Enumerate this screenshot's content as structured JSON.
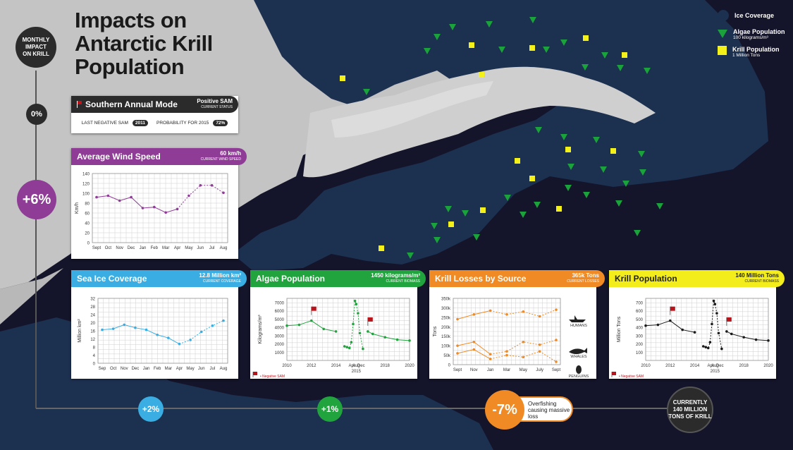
{
  "title": [
    "Impacts on",
    "Antarctic Krill",
    "Population"
  ],
  "timeline": {
    "header": [
      "MONTHLY",
      "IMPACT",
      "ON KRILL"
    ],
    "start": "0%",
    "wind_impact": "+6%",
    "ice_impact": "+2%",
    "algae_impact": "+1%",
    "losses_impact": "-7%",
    "losses_note": [
      "Overfishing",
      "causing massive",
      "loss"
    ],
    "final": [
      "CURRENTLY",
      "140 MILLION",
      "TONS OF KRILL"
    ]
  },
  "legend": {
    "ice": {
      "label": "Ice Coverage",
      "color": "#1b2f4f"
    },
    "algae": {
      "label": "Algae Population",
      "sub": "100 kilograms/m³",
      "color": "#1aa33a"
    },
    "krill": {
      "label": "Krill Population",
      "sub": "1 Million Tons",
      "color": "#f4f01a"
    }
  },
  "sam": {
    "title": "Southern Annual Mode",
    "status": "Positive SAM",
    "status_sub": "CURRENT STATUS",
    "last_label": "LAST NEGATIVE SAM",
    "last_value": "2011",
    "prob_label": "PROBABILITY FOR 2015",
    "prob_value": "72%"
  },
  "panels": {
    "wind": {
      "title": "Average Wind Speed",
      "value": "60 km/h",
      "sub": "CURRENT WIND SPEED",
      "color": "#8e3c95"
    },
    "ice": {
      "title": "Sea Ice Coverage",
      "value": "12.8 Million km²",
      "sub": "CURRENT COVERAGE",
      "color": "#3aaee2"
    },
    "algae": {
      "title": "Algae Population",
      "value": "1450 kilograms/m³",
      "sub": "CURRENT BIOMASS",
      "color": "#21a33e",
      "note": "Negative SAM"
    },
    "losses": {
      "title": "Krill Losses by Source",
      "value": "365k Tons",
      "sub": "CURRENT LOSSES",
      "color": "#f08a24"
    },
    "krill": {
      "title": "Krill Population",
      "value": "140 Million Tons",
      "sub": "CURRENT BIOMASS",
      "color": "#f3ee1b",
      "note": "Negative SAM"
    }
  },
  "chart_data": [
    {
      "type": "line",
      "title": "Average Wind Speed",
      "ylabel": "Km/h",
      "ylim": [
        0,
        140
      ],
      "yticks": [
        "0",
        "20",
        "40",
        "60",
        "80",
        "100",
        "120",
        "140"
      ],
      "categories": [
        "Sept",
        "Oct",
        "Nov",
        "Dec",
        "Jan",
        "Feb",
        "Mar",
        "Apr",
        "May",
        "Jun",
        "Jul",
        "Aug"
      ],
      "values": [
        92,
        95,
        85,
        92,
        70,
        72,
        61,
        68,
        95,
        116,
        116,
        101
      ]
    },
    {
      "type": "line",
      "title": "Sea Ice Coverage",
      "ylabel": "Million km²",
      "ylim": [
        0,
        32
      ],
      "yticks": [
        "0",
        "4",
        "8",
        "12",
        "16",
        "20",
        "24",
        "28",
        "32"
      ],
      "categories": [
        "Sep",
        "Oct",
        "Nov",
        "Dec",
        "Jan",
        "Feb",
        "Mar",
        "Apr",
        "May",
        "Jun",
        "Jul",
        "Aug"
      ],
      "values": [
        16.5,
        17,
        19,
        17.5,
        16.5,
        14,
        12.5,
        9.5,
        11.5,
        15.5,
        18.5,
        21
      ]
    },
    {
      "type": "line",
      "title": "Algae Population",
      "ylabel": "Kilograms/m³",
      "ylim": [
        0,
        7500
      ],
      "yticks": [
        "1000",
        "2000",
        "3000",
        "4000",
        "5000",
        "6000",
        "7000"
      ],
      "xticks": [
        "2010",
        "2012",
        "2014",
        "Apr",
        "Aug",
        "Dec",
        "2018",
        "2020"
      ],
      "x_center_label": "2015",
      "series": [
        {
          "x": [
            2010,
            2011,
            2012,
            2013,
            2014
          ],
          "values": [
            4200,
            4300,
            4800,
            3800,
            3500
          ]
        },
        {
          "x": [
            2014.7,
            2014.9,
            2015.1,
            2015.25,
            2015.4,
            2015.55,
            2015.65,
            2015.8,
            2015.95,
            2016.2
          ],
          "values": [
            1700,
            1600,
            1500,
            2200,
            4400,
            7200,
            6800,
            5700,
            3300,
            1400
          ]
        },
        {
          "x": [
            2016.6,
            2017,
            2018,
            2019,
            2020
          ],
          "values": [
            3500,
            3200,
            2800,
            2500,
            2400
          ]
        }
      ],
      "flags": [
        2012,
        2016.6
      ]
    },
    {
      "type": "line",
      "title": "Krill Losses by Source",
      "ylabel": "Tons",
      "ylim": [
        0,
        350000
      ],
      "yticks": [
        "0",
        "50k",
        "100k",
        "150k",
        "200k",
        "250k",
        "300k",
        "350k"
      ],
      "categories": [
        "Sept",
        "Nov",
        "Jan",
        "Mar",
        "May",
        "July",
        "Sept"
      ],
      "series": [
        {
          "name": "HUMANS",
          "values": [
            240000,
            265000,
            285000,
            265000,
            280000,
            255000,
            290000
          ]
        },
        {
          "name": "WHALES",
          "values": [
            100000,
            120000,
            55000,
            70000,
            120000,
            105000,
            130000
          ]
        },
        {
          "name": "PENGUINS",
          "values": [
            60000,
            80000,
            30000,
            50000,
            40000,
            70000,
            15000
          ]
        }
      ]
    },
    {
      "type": "line",
      "title": "Krill Population",
      "ylabel": "Million Tons",
      "ylim": [
        0,
        750
      ],
      "yticks": [
        "100",
        "200",
        "300",
        "400",
        "500",
        "600",
        "700"
      ],
      "xticks": [
        "2010",
        "2012",
        "2014",
        "Apr",
        "Aug",
        "Dec",
        "2018",
        "2020"
      ],
      "x_center_label": "2015",
      "series": [
        {
          "x": [
            2010,
            2011,
            2012,
            2013,
            2014
          ],
          "values": [
            420,
            430,
            480,
            370,
            340
          ]
        },
        {
          "x": [
            2014.7,
            2014.9,
            2015.1,
            2015.25,
            2015.4,
            2015.55,
            2015.65,
            2015.8,
            2015.95,
            2016.2
          ],
          "values": [
            170,
            160,
            150,
            220,
            440,
            720,
            680,
            570,
            330,
            140
          ]
        },
        {
          "x": [
            2016.6,
            2017,
            2018,
            2019,
            2020
          ],
          "values": [
            350,
            320,
            280,
            250,
            240
          ]
        }
      ],
      "flags": [
        2012,
        2016.6
      ]
    }
  ]
}
